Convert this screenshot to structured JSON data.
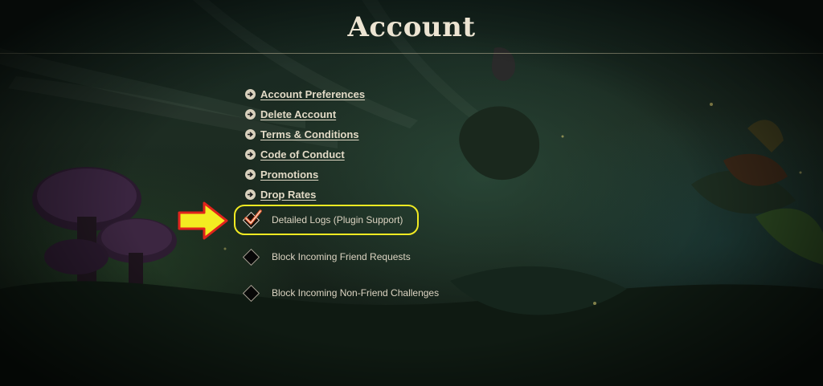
{
  "page": {
    "title": "Account"
  },
  "menu": [
    {
      "label": "Account Preferences",
      "icon": "arrow-circle-right-icon"
    },
    {
      "label": "Delete Account",
      "icon": "arrow-circle-right-icon"
    },
    {
      "label": "Terms & Conditions",
      "icon": "arrow-circle-right-icon"
    },
    {
      "label": "Code of Conduct",
      "icon": "arrow-circle-right-icon"
    },
    {
      "label": "Promotions",
      "icon": "arrow-circle-right-icon"
    },
    {
      "label": "Drop Rates",
      "icon": "arrow-circle-right-icon"
    }
  ],
  "options": [
    {
      "label": "Detailed Logs (Plugin Support)",
      "checked": true,
      "highlighted": true
    },
    {
      "label": "Block Incoming Friend Requests",
      "checked": false
    },
    {
      "label": "Block Incoming Non-Friend Challenges",
      "checked": false
    }
  ],
  "annotation": {
    "arrow_color": "#f3ec21",
    "arrow_outline": "#e0231c",
    "highlight_color": "#f1ea22"
  },
  "colors": {
    "text_primary": "#e2dac6",
    "checkmark": "#e4582c"
  }
}
